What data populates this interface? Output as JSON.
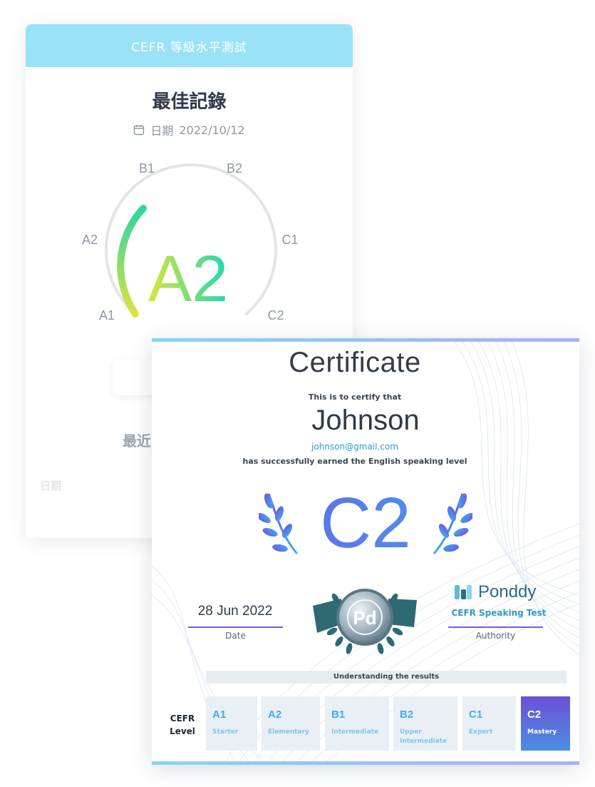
{
  "result_card": {
    "header_title": "CEFR 等級水平測試",
    "best_record_title": "最佳記錄",
    "date_label": "日期",
    "date_value": "2022/10/12",
    "gauge": {
      "current_level": "A2",
      "levels": [
        "A1",
        "A2",
        "B1",
        "B2",
        "C1",
        "C2"
      ],
      "progress_fraction": 0.33,
      "gradient_colors": [
        "#d8e53a",
        "#2fd6a0"
      ]
    },
    "recent_heading_partial": "最近",
    "column_header": "日期"
  },
  "certificate": {
    "title": "Certificate",
    "certify_text": "This is to certify that",
    "recipient_name": "Johnson",
    "recipient_email": "johnson@gmail.com",
    "earned_text": "has successfully earned the English speaking level",
    "level": "C2",
    "date_value": "28 Jun 2022",
    "date_caption": "Date",
    "brand_name": "Ponddy",
    "brand_subtitle": "CEFR Speaking Test",
    "authority_caption": "Authority",
    "results_heading": "Understanding the results",
    "cefr_label_line1": "CEFR",
    "cefr_label_line2": "Level",
    "levels": [
      {
        "code": "A1",
        "name_line1": "Starter",
        "name_line2": ""
      },
      {
        "code": "A2",
        "name_line1": "Elementary",
        "name_line2": ""
      },
      {
        "code": "B1",
        "name_line1": "Intermediate",
        "name_line2": ""
      },
      {
        "code": "B2",
        "name_line1": "Upper",
        "name_line2": "Intermediate"
      },
      {
        "code": "C1",
        "name_line1": "Expert",
        "name_line2": ""
      },
      {
        "code": "C2",
        "name_line1": "Mastery",
        "name_line2": ""
      }
    ],
    "active_level_index": 5,
    "accent_colors": [
      "#6d50e0",
      "#40b2f0"
    ]
  }
}
